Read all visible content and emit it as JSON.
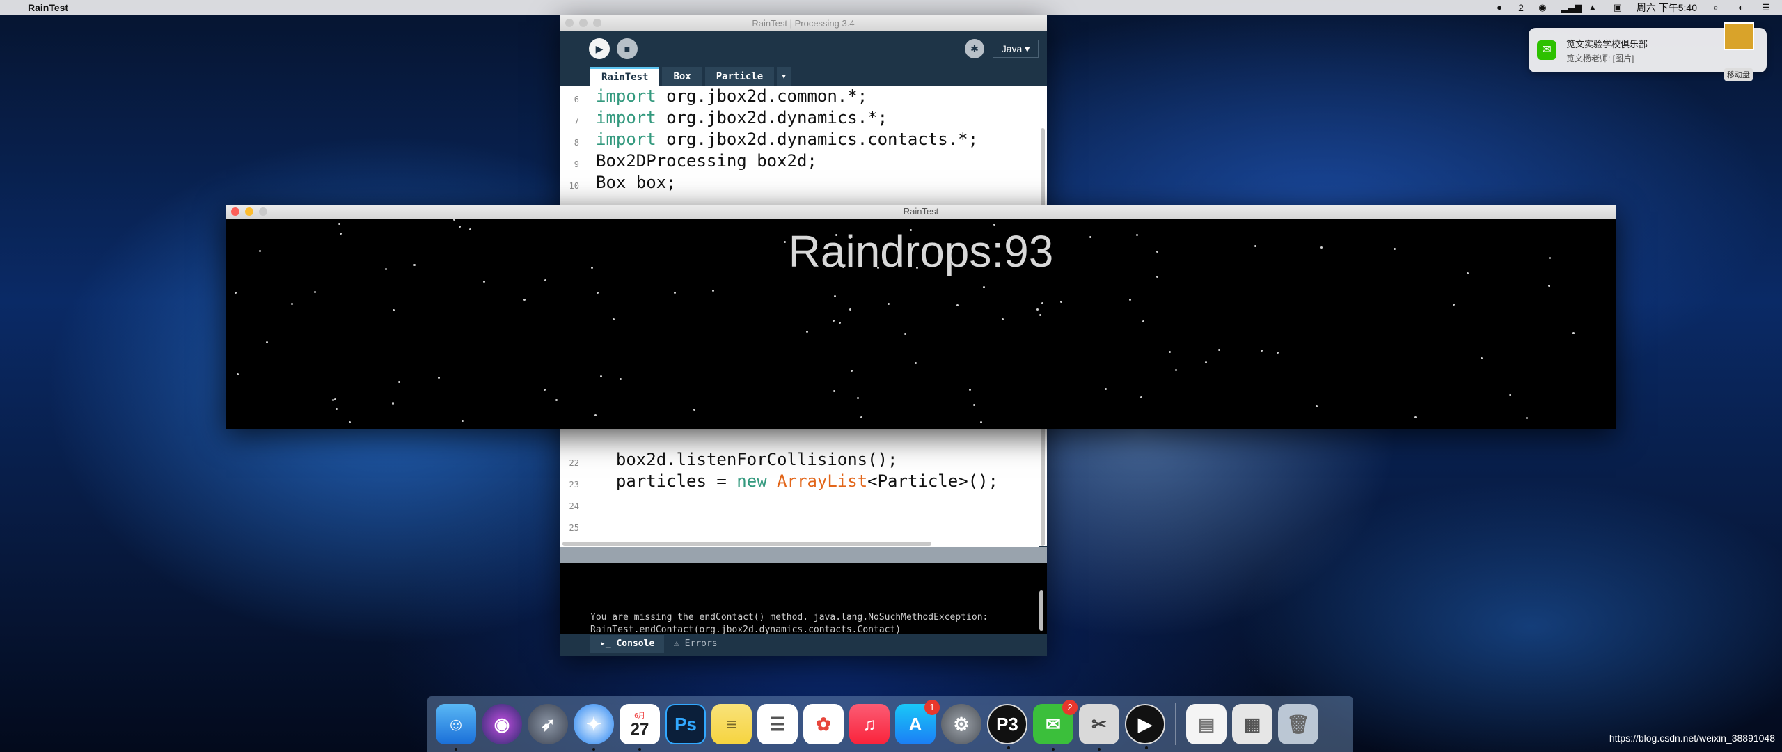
{
  "menubar": {
    "apple": "",
    "app_name": "RainTest",
    "wechat_count": "2",
    "datetime": "周六 下午5:40"
  },
  "notification": {
    "title": "笕文实验学校俱乐部",
    "body": "笕文杨老师: [图片]",
    "tag": "移动盘"
  },
  "ide": {
    "title": "RainTest | Processing 3.4",
    "mode": "Java ▾",
    "tabs": [
      "RainTest",
      "Box",
      "Particle"
    ],
    "tab_menu": "▾",
    "code_top": [
      {
        "num": "6",
        "kw": "import",
        "rest": " org.jbox2d.common.*;"
      },
      {
        "num": "7",
        "kw": "import",
        "rest": " org.jbox2d.dynamics.*;"
      },
      {
        "num": "8",
        "kw": "import",
        "rest": " org.jbox2d.dynamics.contacts.*;"
      },
      {
        "num": "9",
        "kw": "",
        "rest": "Box2DProcessing box2d;"
      },
      {
        "num": "10",
        "kw": "",
        "rest": "Box box;"
      }
    ],
    "code_bottom": [
      {
        "num": "22",
        "text": "  box2d.listenForCollisions();"
      },
      {
        "num": "23",
        "pre": "  particles = ",
        "kw1": "new",
        "mid": " ",
        "kw2": "ArrayList",
        "post": "<Particle>();"
      },
      {
        "num": "24",
        "text": ""
      },
      {
        "num": "25",
        "text": ""
      }
    ],
    "console_message": "You are missing the endContact() method. java.lang.NoSuchMethodException:\nRainTest.endContact(org.jbox2d.dynamics.contacts.Contact)",
    "footer_tabs": [
      "Console",
      "Errors"
    ]
  },
  "sketch": {
    "title": "RainTest",
    "counter": "Raindrops:93"
  },
  "dock": {
    "calendar_month": "6月",
    "calendar_day": "27",
    "appstore_badge": "1",
    "wechat_badge": "2"
  },
  "watermark": "https://blog.csdn.net/weixin_38891048"
}
